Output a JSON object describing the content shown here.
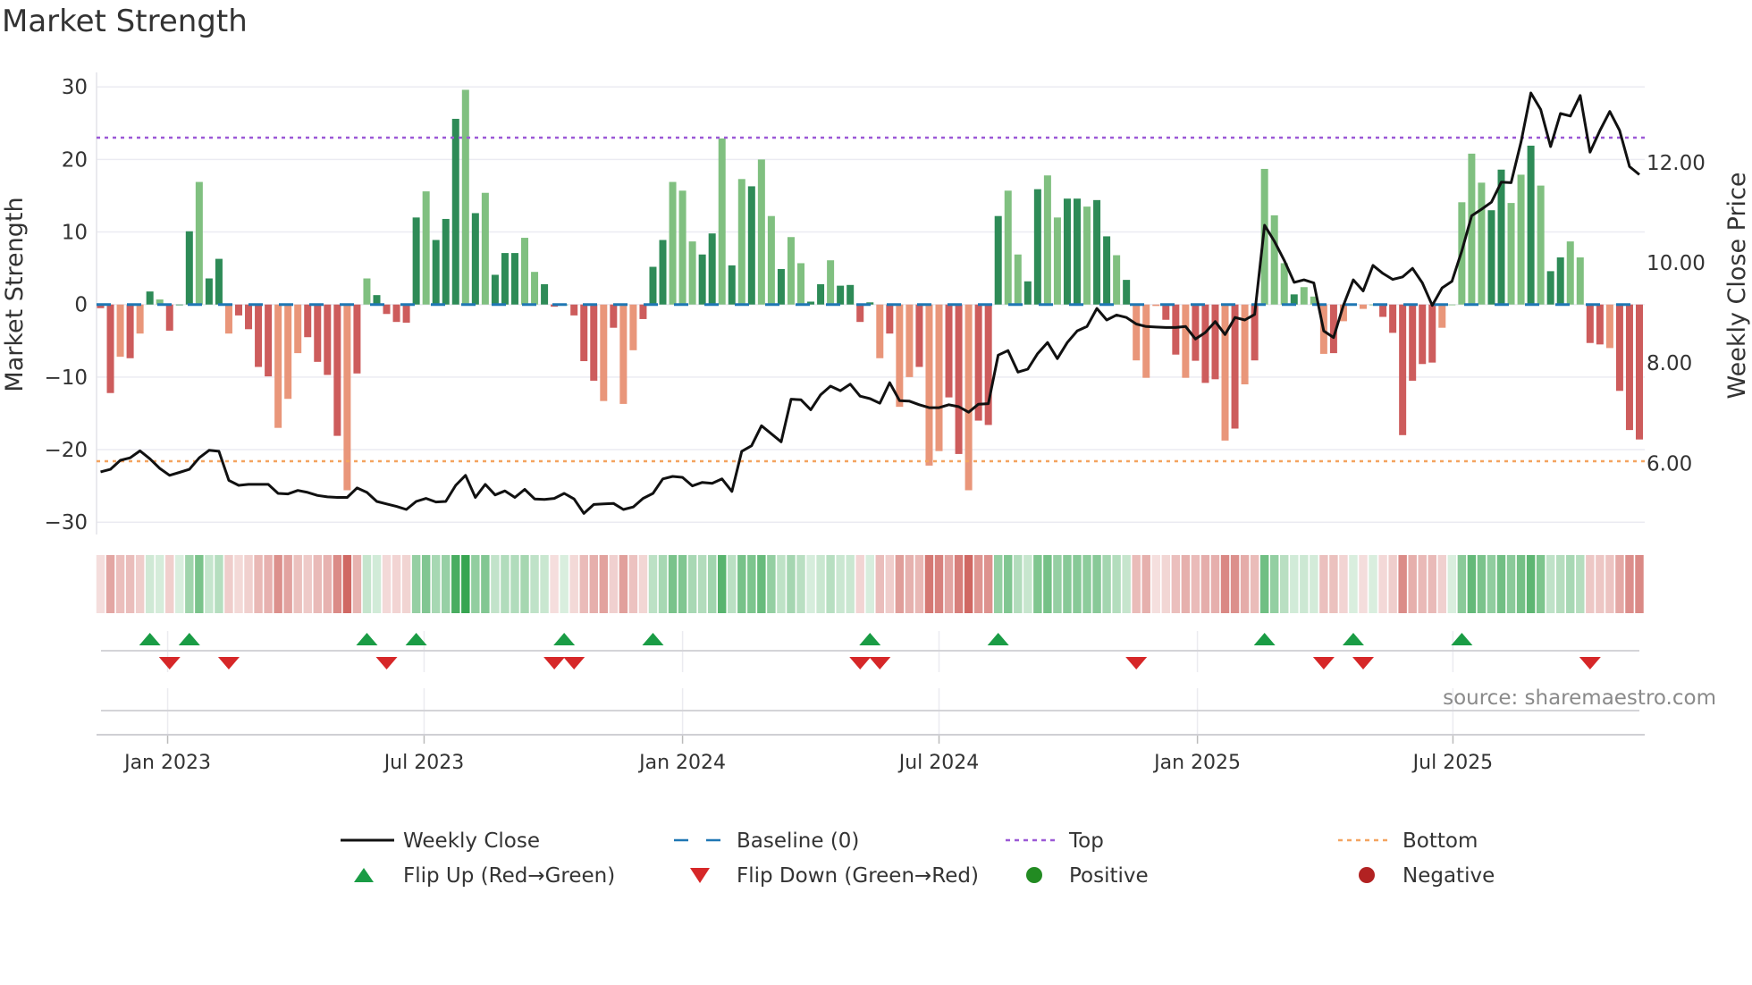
{
  "title": "Market Strength",
  "source": "source: sharemaestro.com",
  "chart_data": {
    "type": "bar",
    "title": "Market Strength",
    "ylabel": "Market Strength",
    "ylabel_right": "Weekly Close Price",
    "ylim": [
      -31.7,
      32
    ],
    "ylim_right": [
      4.58,
      13.8
    ],
    "yticks": [
      "30",
      "20",
      "10",
      "0",
      "−10",
      "−20",
      "−30"
    ],
    "ytick_values": [
      30,
      20,
      10,
      0,
      -10,
      -20,
      -30
    ],
    "yticks_right": [
      "12.00",
      "10.00",
      "8.00",
      "6.00"
    ],
    "ytick_right_values": [
      12,
      10,
      8,
      6
    ],
    "xticks": [
      "Jan 2023",
      "Jul 2023",
      "Jan 2024",
      "Jul 2024",
      "Jan 2025",
      "Jul 2025"
    ],
    "grid": true,
    "legend_position": "bottom",
    "top_level": 23,
    "bottom_level": -21.6,
    "baseline": 0,
    "strength": [
      -0.5,
      -12.2,
      -7.2,
      -7.4,
      -4,
      1.8,
      0.7,
      -3.6,
      0,
      10.1,
      16.9,
      3.6,
      6.3,
      -4,
      -1.5,
      -3.4,
      -8.6,
      -9.9,
      -17,
      -13,
      -6.7,
      -4.5,
      -7.9,
      -9.7,
      -18.1,
      -25.6,
      -9.5,
      3.6,
      1.3,
      -1.3,
      -2.4,
      -2.5,
      12,
      15.6,
      8.9,
      11.8,
      25.6,
      29.6,
      12.6,
      15.4,
      4.1,
      7.1,
      7.1,
      9.2,
      4.5,
      2.8,
      -0.3,
      0,
      -1.5,
      -7.8,
      -10.5,
      -13.3,
      -3.2,
      -13.7,
      -6.3,
      -2,
      5.2,
      8.9,
      16.9,
      15.7,
      8.7,
      6.9,
      9.8,
      22.9,
      5.4,
      17.3,
      16.3,
      20,
      12.2,
      4.9,
      9.3,
      5.7,
      0.4,
      2.8,
      6.1,
      2.6,
      2.7,
      -2.4,
      0.3,
      -7.4,
      -4,
      -14.1,
      -10,
      -8.6,
      -22.2,
      -20.2,
      -12.8,
      -20.6,
      -25.6,
      -16,
      -16.6,
      12.2,
      15.7,
      6.9,
      3.2,
      15.9,
      17.8,
      12,
      14.6,
      14.6,
      13.5,
      14.4,
      9.4,
      6.8,
      3.4,
      -7.7,
      -10.1,
      -0.2,
      -2.1,
      -6.9,
      -10.1,
      -7.75,
      -10.8,
      -10.3,
      -18.75,
      -17.1,
      -11,
      -7.7,
      18.7,
      12.3,
      5.7,
      1.4,
      2.4,
      1.1,
      -6.8,
      -6.7,
      -2.3,
      0,
      -0.6,
      0,
      -1.7,
      -3.9,
      -18,
      -10.5,
      -8.2,
      -8,
      -3.2,
      0,
      14.1,
      20.8,
      16.8,
      13,
      18.6,
      14,
      17.9,
      21.9,
      16.4,
      4.6,
      6.5,
      8.7,
      6.5,
      -5.3,
      -5.5,
      -6,
      -11.9,
      -17.3,
      -18.6
    ],
    "shade": "ddldldldddlddlddddlllddddldldddddldddldldddlldddd ddldlldddlllddldldlldllddlddddldlldllddldddllddllddlddldlllddldddldldllldllldldllddddddlllllddlldlddllddldddddd",
    "weekly_close": [
      5.83,
      5.88,
      6.06,
      6.11,
      6.25,
      6.09,
      5.9,
      5.76,
      5.82,
      5.88,
      6.11,
      6.26,
      6.24,
      5.66,
      5.56,
      5.58,
      5.58,
      5.58,
      5.4,
      5.39,
      5.46,
      5.42,
      5.36,
      5.33,
      5.32,
      5.32,
      5.51,
      5.42,
      5.24,
      5.19,
      5.14,
      5.08,
      5.24,
      5.3,
      5.23,
      5.24,
      5.56,
      5.76,
      5.32,
      5.58,
      5.37,
      5.45,
      5.32,
      5.48,
      5.29,
      5.28,
      5.3,
      5.4,
      5.29,
      5.0,
      5.18,
      5.19,
      5.2,
      5.08,
      5.13,
      5.3,
      5.4,
      5.69,
      5.74,
      5.72,
      5.55,
      5.62,
      5.6,
      5.69,
      5.44,
      6.24,
      6.35,
      6.75,
      6.59,
      6.43,
      7.28,
      7.27,
      7.07,
      7.37,
      7.54,
      7.45,
      7.58,
      7.34,
      7.29,
      7.2,
      7.61,
      7.25,
      7.24,
      7.17,
      7.11,
      7.11,
      7.17,
      7.13,
      7.02,
      7.18,
      7.19,
      8.16,
      8.25,
      7.82,
      7.88,
      8.19,
      8.41,
      8.09,
      8.41,
      8.64,
      8.73,
      9.09,
      8.86,
      8.96,
      8.91,
      8.78,
      8.73,
      8.72,
      8.71,
      8.71,
      8.73,
      8.48,
      8.61,
      8.83,
      8.57,
      8.91,
      8.86,
      8.97,
      10.75,
      10.43,
      10.05,
      9.61,
      9.66,
      9.6,
      8.64,
      8.51,
      9.15,
      9.66,
      9.44,
      9.95,
      9.79,
      9.67,
      9.72,
      9.89,
      9.6,
      9.15,
      9.5,
      9.63,
      10.24,
      10.94,
      11.07,
      11.21,
      11.61,
      11.6,
      12.41,
      13.39,
      13.06,
      12.32,
      12.98,
      12.93,
      13.34,
      12.21,
      12.64,
      13.02,
      12.64,
      11.92,
      11.76
    ],
    "flip_up_weeks": [
      5,
      9,
      27,
      32,
      47,
      56,
      78,
      91,
      118,
      127,
      138
    ],
    "flip_down_weeks": [
      7,
      13,
      29,
      46,
      48,
      77,
      79,
      105,
      124,
      128,
      151
    ],
    "legend": [
      {
        "label": "Weekly Close",
        "symbol": "line"
      },
      {
        "label": "Baseline (0)",
        "symbol": "dashed"
      },
      {
        "label": "Top",
        "symbol": "dotted"
      },
      {
        "label": "Bottom",
        "symbol": "dotted"
      },
      {
        "label": "Flip Up (Red→Green)",
        "symbol": "triangle-up"
      },
      {
        "label": "Flip Down (Green→Red)",
        "symbol": "triangle-down"
      },
      {
        "label": "Positive",
        "symbol": "circle"
      },
      {
        "label": "Negative",
        "symbol": "circle"
      }
    ],
    "colors": {
      "strong_positive": "#2e8b57",
      "weak_positive": "#80c080",
      "strong_negative": "#cd5c5c",
      "weak_negative": "#e9967a",
      "close_line": "#111111",
      "baseline": "#1f77b4",
      "top": "#9b59d6",
      "bottom": "#f4a460",
      "flip_up": "#1a9c45",
      "flip_down": "#d62728",
      "positive_dot": "#228b22",
      "negative_dot": "#b22222",
      "heat_positive": "#2ca048",
      "heat_negative": "#c8504a"
    }
  }
}
